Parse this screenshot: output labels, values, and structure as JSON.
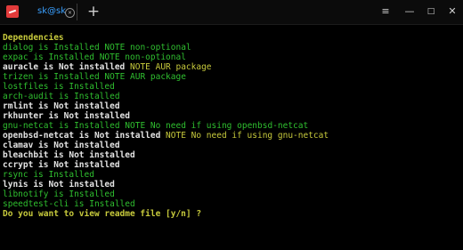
{
  "titlebar": {
    "tab_title": "sk@sk",
    "tab_close": "×",
    "new_tab": "+",
    "menu": "≡",
    "minimize": "—",
    "maximize": "□",
    "close": "✕"
  },
  "terminal": {
    "heading": "Dependencies",
    "lines": [
      {
        "pkg": "dialog is Installed",
        "note": "NOTE non-optional"
      },
      {
        "pkg": "expac is Installed",
        "note": "NOTE non-optional"
      },
      {
        "pkg": "auracle is Not installed",
        "note": "NOTE AUR package"
      },
      {
        "pkg": "trizen is Installed",
        "note": "NOTE AUR package"
      },
      {
        "pkg": "lostfiles is Installed",
        "note": ""
      },
      {
        "pkg": "arch-audit is Installed",
        "note": ""
      },
      {
        "pkg": "rmlint is Not installed",
        "note": ""
      },
      {
        "pkg": "rkhunter is Not installed",
        "note": ""
      },
      {
        "pkg": "gnu-netcat is Installed",
        "note": "NOTE No need if using openbsd-netcat"
      },
      {
        "pkg": "openbsd-netcat is Not installed",
        "note": "NOTE No need if using gnu-netcat"
      },
      {
        "pkg": "clamav is Not installed",
        "note": ""
      },
      {
        "pkg": "bleachbit is Not installed",
        "note": ""
      },
      {
        "pkg": "ccrypt is Not installed",
        "note": ""
      },
      {
        "pkg": "rsync is Installed",
        "note": ""
      },
      {
        "pkg": "lynis is Not installed",
        "note": ""
      },
      {
        "pkg": "libnotify is Installed",
        "note": ""
      },
      {
        "pkg": "speedtest-cli is Installed",
        "note": ""
      }
    ],
    "prompt": "Do you want to view readme file [y/n] ?"
  }
}
